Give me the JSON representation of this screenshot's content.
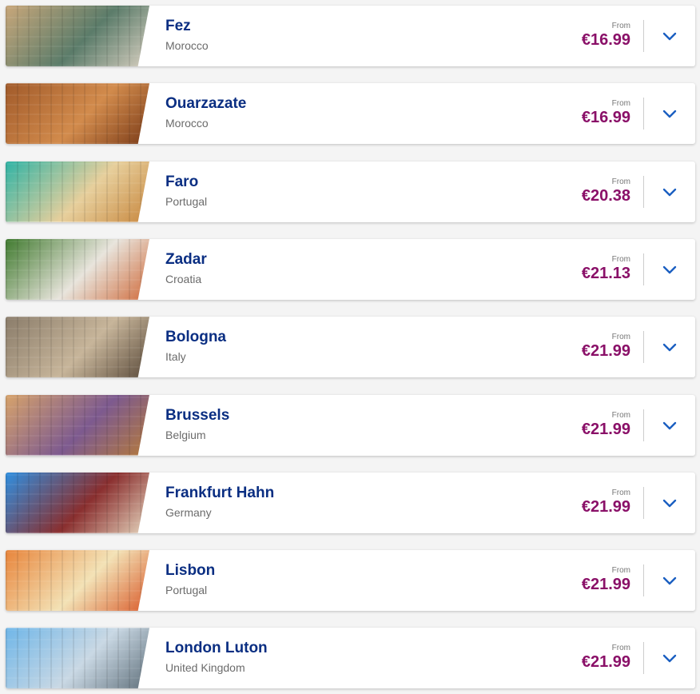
{
  "destinations": [
    {
      "city": "Fez",
      "country": "Morocco",
      "from_label": "From",
      "price": "€16.99",
      "image_icon": "fez-gate-photo",
      "colors": [
        "#c9a77a",
        "#5b7c6a",
        "#d8cfc0"
      ]
    },
    {
      "city": "Ouarzazate",
      "country": "Morocco",
      "from_label": "From",
      "price": "€16.99",
      "image_icon": "ouarzazate-kasbah-photo",
      "colors": [
        "#a15a2a",
        "#d28b4c",
        "#7a3b18"
      ]
    },
    {
      "city": "Faro",
      "country": "Portugal",
      "from_label": "From",
      "price": "€20.38",
      "image_icon": "faro-beach-photo",
      "colors": [
        "#2fb3a5",
        "#e7cf9c",
        "#c8873e"
      ]
    },
    {
      "city": "Zadar",
      "country": "Croatia",
      "from_label": "From",
      "price": "€21.13",
      "image_icon": "zadar-villa-photo",
      "colors": [
        "#3f7a2e",
        "#e8e4dc",
        "#d06a3a"
      ]
    },
    {
      "city": "Bologna",
      "country": "Italy",
      "from_label": "From",
      "price": "€21.99",
      "image_icon": "bologna-rooftops-photo",
      "colors": [
        "#8a7c6a",
        "#c7b59a",
        "#5a4a3a"
      ]
    },
    {
      "city": "Brussels",
      "country": "Belgium",
      "from_label": "From",
      "price": "€21.99",
      "image_icon": "brussels-grand-place-photo",
      "colors": [
        "#d7a36b",
        "#7d5a8f",
        "#b57a3a"
      ]
    },
    {
      "city": "Frankfurt Hahn",
      "country": "Germany",
      "from_label": "From",
      "price": "€21.99",
      "image_icon": "frankfurt-timber-houses-photo",
      "colors": [
        "#2f8fe0",
        "#8a2f2f",
        "#e7d8c0"
      ]
    },
    {
      "city": "Lisbon",
      "country": "Portugal",
      "from_label": "From",
      "price": "€21.99",
      "image_icon": "lisbon-rooftops-photo",
      "colors": [
        "#e8843a",
        "#f3e2b6",
        "#d95a2a"
      ]
    },
    {
      "city": "London Luton",
      "country": "United Kingdom",
      "from_label": "From",
      "price": "€21.99",
      "image_icon": "tower-bridge-photo",
      "colors": [
        "#6fb6e8",
        "#c9d8e4",
        "#5f6f7a"
      ]
    }
  ],
  "expand_icon": "chevron-down-icon",
  "accent": {
    "city": "#0a2e82",
    "price": "#8a1068",
    "chevron": "#1b5fc1"
  }
}
